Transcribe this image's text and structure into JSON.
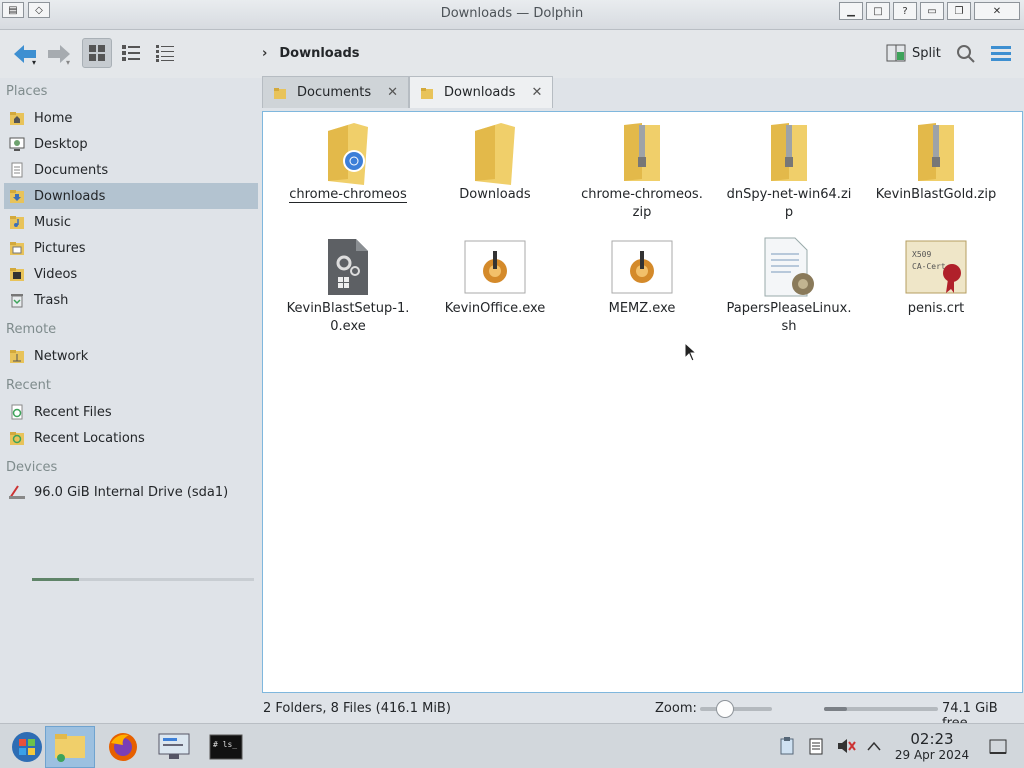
{
  "window": {
    "title": "Downloads — Dolphin"
  },
  "toolbar": {
    "back_icon": "back-arrow-icon",
    "forward_icon": "forward-arrow-icon",
    "breadcrumb_current": "Downloads",
    "split_label": "Split"
  },
  "sidebar": {
    "places_title": "Places",
    "places": [
      {
        "label": "Home",
        "icon": "home-folder-icon"
      },
      {
        "label": "Desktop",
        "icon": "desktop-icon"
      },
      {
        "label": "Documents",
        "icon": "documents-folder-icon"
      },
      {
        "label": "Downloads",
        "icon": "downloads-folder-icon",
        "selected": true
      },
      {
        "label": "Music",
        "icon": "music-folder-icon"
      },
      {
        "label": "Pictures",
        "icon": "pictures-folder-icon"
      },
      {
        "label": "Videos",
        "icon": "videos-folder-icon"
      },
      {
        "label": "Trash",
        "icon": "trash-icon"
      }
    ],
    "remote_title": "Remote",
    "remote": [
      {
        "label": "Network",
        "icon": "network-folder-icon"
      }
    ],
    "recent_title": "Recent",
    "recent": [
      {
        "label": "Recent Files",
        "icon": "recent-files-icon"
      },
      {
        "label": "Recent Locations",
        "icon": "recent-locations-icon"
      }
    ],
    "devices_title": "Devices",
    "devices": [
      {
        "label": "96.0 GiB Internal Drive (sda1)",
        "icon": "drive-icon",
        "usage_fraction": 0.21
      }
    ]
  },
  "tabs": [
    {
      "label": "Documents",
      "active": false
    },
    {
      "label": "Downloads",
      "active": true
    }
  ],
  "files": [
    {
      "name": "chrome-chromeos",
      "type": "folder-chrome"
    },
    {
      "name": "Downloads",
      "type": "folder"
    },
    {
      "name": "chrome-chromeos.zip",
      "type": "zip"
    },
    {
      "name": "dnSpy-net-win64.zip",
      "type": "zip"
    },
    {
      "name": "KevinBlastGold.zip",
      "type": "zip"
    },
    {
      "name": "KevinBlastSetup-1.0.exe",
      "type": "exe-gear"
    },
    {
      "name": "KevinOffice.exe",
      "type": "exe-wine"
    },
    {
      "name": "MEMZ.exe",
      "type": "exe-wine"
    },
    {
      "name": "PapersPleaseLinux.sh",
      "type": "script"
    },
    {
      "name": "penis.crt",
      "type": "certificate"
    }
  ],
  "status": {
    "summary": "2 Folders, 8 Files (416.1 MiB)",
    "zoom_label": "Zoom:",
    "zoom_fraction": 0.35,
    "free_text": "74.1 GiB free",
    "used_fraction": 0.2
  },
  "taskbar": {
    "time": "02:23",
    "date": "29 Apr 2024",
    "apps": [
      "start-menu-icon",
      "dolphin-icon",
      "firefox-icon",
      "system-settings-icon",
      "terminal-icon"
    ]
  }
}
